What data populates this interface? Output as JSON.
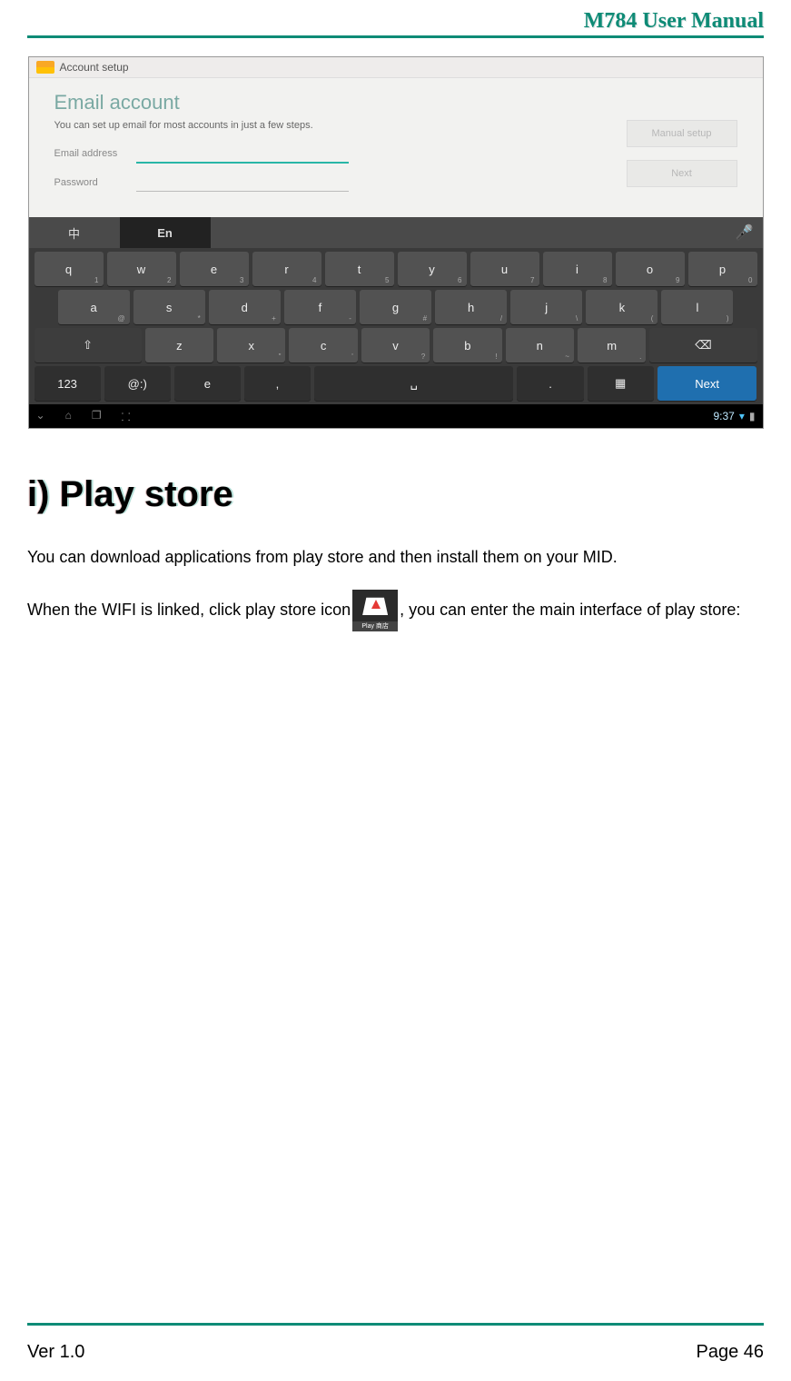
{
  "header": {
    "title": "M784  User  Manual"
  },
  "screenshot": {
    "account_bar": "Account setup",
    "title": "Email account",
    "hint": "You can set up email for most accounts in just a few steps.",
    "email_label": "Email address",
    "password_label": "Password",
    "manual_btn": "Manual setup",
    "next_btn": "Next",
    "keyboard": {
      "tab_zh": "中",
      "tab_en": "En",
      "row1": [
        {
          "m": "q",
          "s": "1"
        },
        {
          "m": "w",
          "s": "2"
        },
        {
          "m": "e",
          "s": "3"
        },
        {
          "m": "r",
          "s": "4"
        },
        {
          "m": "t",
          "s": "5"
        },
        {
          "m": "y",
          "s": "6"
        },
        {
          "m": "u",
          "s": "7"
        },
        {
          "m": "i",
          "s": "8"
        },
        {
          "m": "o",
          "s": "9"
        },
        {
          "m": "p",
          "s": "0"
        }
      ],
      "row2": [
        {
          "m": "a",
          "s": "@"
        },
        {
          "m": "s",
          "s": "*"
        },
        {
          "m": "d",
          "s": "+"
        },
        {
          "m": "f",
          "s": "-"
        },
        {
          "m": "g",
          "s": "#"
        },
        {
          "m": "h",
          "s": "/"
        },
        {
          "m": "j",
          "s": "\\"
        },
        {
          "m": "k",
          "s": "("
        },
        {
          "m": "l",
          "s": ")"
        }
      ],
      "row3": [
        {
          "m": "z",
          "s": ""
        },
        {
          "m": "x",
          "s": "\""
        },
        {
          "m": "c",
          "s": "'"
        },
        {
          "m": "v",
          "s": "?"
        },
        {
          "m": "b",
          "s": "!"
        },
        {
          "m": "n",
          "s": "~"
        },
        {
          "m": "m",
          "s": "."
        }
      ],
      "shift_icon": "⇧",
      "backspace_icon": "⌫",
      "key_123": "123",
      "key_emoji": "@:)",
      "key_e": "e",
      "key_comma": ",",
      "key_space": "␣",
      "key_period": ".",
      "key_grid": "▦",
      "key_next": "Next",
      "clock": "9:37",
      "nav_down": "⌄",
      "nav_home": "⌂",
      "nav_recent": "❐",
      "nav_menu": "⸬",
      "wifi_icon": "▾",
      "batt_icon": "▮"
    }
  },
  "section": {
    "title": "i)  Play store",
    "p1": "You can download applications from play store and then install them on your MID.",
    "p2a": "When the WIFI is linked, click play store icon",
    "p2b": ", you can enter the main interface of play store:",
    "play_cap": "Play 商店"
  },
  "footer": {
    "ver": "Ver 1.0",
    "page": "Page 46"
  }
}
